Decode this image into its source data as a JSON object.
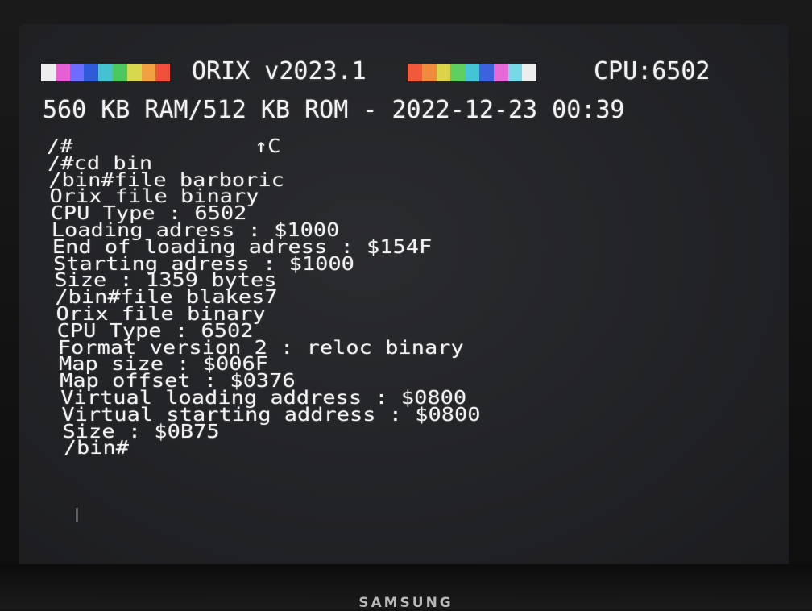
{
  "device": {
    "brand": "SAMSUNG"
  },
  "header": {
    "os_title": "ORIX v2023.1",
    "cpu_label": "CPU:6502",
    "left_colorbar": [
      "#ededed",
      "#e85fd3",
      "#6d6dff",
      "#2f5ad8",
      "#47c1d2",
      "#4cc75e",
      "#d8d84f",
      "#f0a144",
      "#f0503c"
    ],
    "right_colorbar": [
      "#f05a3a",
      "#f08a3f",
      "#ddd34a",
      "#5fcf62",
      "#45c4d5",
      "#3c62de",
      "#e56ad8",
      "#77d9e5",
      "#ededed"
    ]
  },
  "status": {
    "text": "560 KB RAM/512 KB ROM - 2022-12-23 00:39"
  },
  "console": {
    "prompt_line": "/#",
    "ctrl_indicator": "↑C",
    "lines": [
      "/#cd bin",
      "/bin#file barboric",
      "Orix file binary",
      "CPU Type : 6502",
      "Loading adress : $1000",
      "End of loading adress : $154F",
      "Starting adress : $1000",
      "Size : 1359 bytes",
      "/bin#file blakes7",
      "Orix file binary",
      "CPU Type : 6502",
      "Format version 2 : reloc binary",
      "Map size : $006F",
      "Map offset : $0376",
      "Virtual loading address : $0800",
      "Virtual starting address : $0800",
      "Size : $0B75",
      "/bin#"
    ]
  }
}
